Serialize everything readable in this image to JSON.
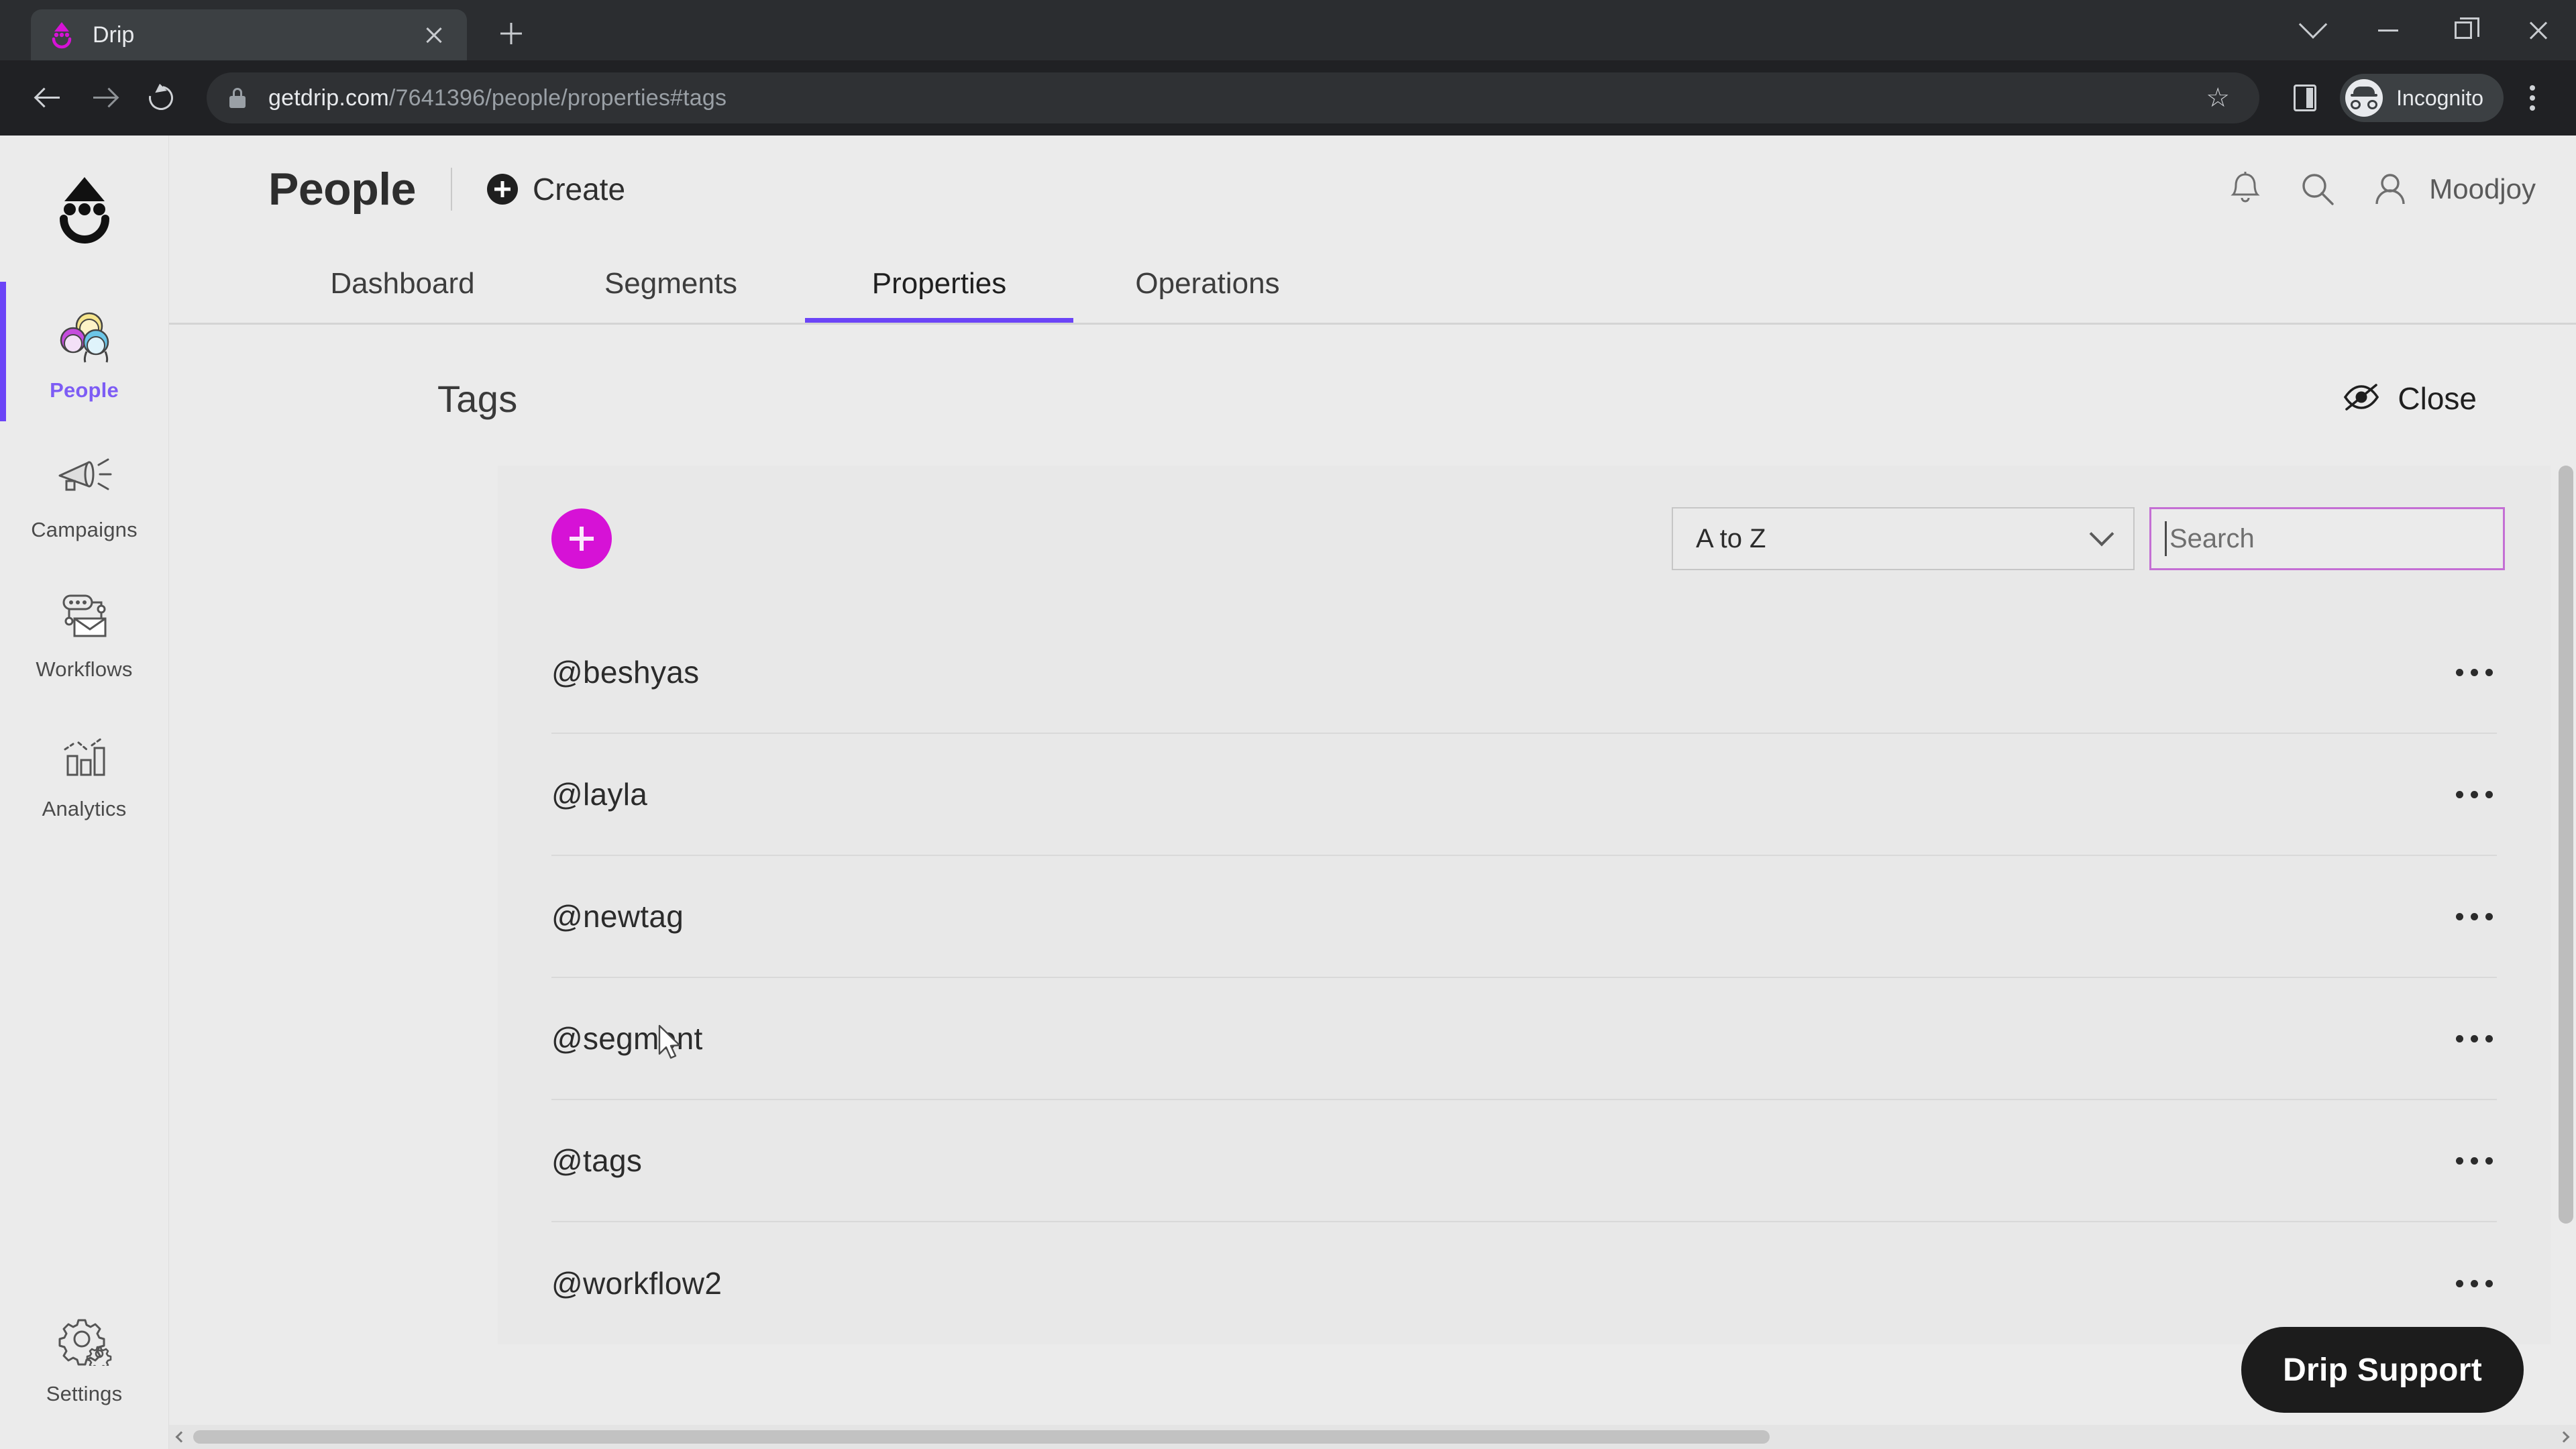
{
  "browser": {
    "tab": {
      "title": "Drip",
      "favicon": "drip-logo-icon",
      "close": "close-tab-icon"
    },
    "new_tab": "+",
    "window_controls": {
      "minimize_to_tray": "chevron-down-icon",
      "minimize": "minimize-icon",
      "maximize": "restore-icon",
      "close": "close-window-icon"
    },
    "nav": {
      "back": "back-arrow-icon",
      "forward": "forward-arrow-icon",
      "reload": "reload-icon"
    },
    "address": {
      "lock": "lock-icon",
      "host": "getdrip.com",
      "path": "/7641396/people/properties#tags",
      "full": "getdrip.com/7641396/people/properties#tags",
      "bookmark": "star-icon"
    },
    "side_panel": "side-panel-icon",
    "profile": {
      "label": "Incognito",
      "icon": "incognito-icon"
    },
    "menu": "three-dot-menu-icon"
  },
  "sidebar": {
    "brand": "drip-logo",
    "items": [
      {
        "label": "People",
        "icon": "people-icon",
        "active": true
      },
      {
        "label": "Campaigns",
        "icon": "megaphone-icon",
        "active": false
      },
      {
        "label": "Workflows",
        "icon": "workflow-icon",
        "active": false
      },
      {
        "label": "Analytics",
        "icon": "bar-chart-icon",
        "active": false
      }
    ],
    "settings": {
      "label": "Settings",
      "icon": "gears-icon"
    }
  },
  "header": {
    "title": "People",
    "create_label": "Create",
    "create_icon": "plus-circle-icon",
    "notifications_icon": "bell-icon",
    "search_icon": "search-icon",
    "account_icon": "person-icon",
    "account_name": "Moodjoy"
  },
  "tabs": [
    {
      "label": "Dashboard",
      "active": false
    },
    {
      "label": "Segments",
      "active": false
    },
    {
      "label": "Properties",
      "active": true
    },
    {
      "label": "Operations",
      "active": false
    }
  ],
  "section": {
    "title": "Tags",
    "close_label": "Close",
    "close_icon": "eye-off-icon"
  },
  "toolbar": {
    "add_icon": "plus-icon",
    "sort_value": "A to Z",
    "sort_chevron": "chevron-down-icon",
    "search_placeholder": "Search",
    "search_value": ""
  },
  "tags": [
    {
      "name": "@beshyas",
      "menu": "more-options-icon"
    },
    {
      "name": "@layla",
      "menu": "more-options-icon"
    },
    {
      "name": "@newtag",
      "menu": "more-options-icon"
    },
    {
      "name": "@segment",
      "menu": "more-options-icon"
    },
    {
      "name": "@tags",
      "menu": "more-options-icon"
    },
    {
      "name": "@workflow2",
      "menu": "more-options-icon"
    }
  ],
  "support": {
    "label": "Drip Support"
  },
  "colors": {
    "accent_purple": "#6b44f7",
    "accent_magenta": "#d612d6",
    "search_focus_border": "#c46fd4",
    "app_background": "#ebebeb",
    "card_background": "#e8e8e8",
    "browser_chrome": "#202124"
  }
}
